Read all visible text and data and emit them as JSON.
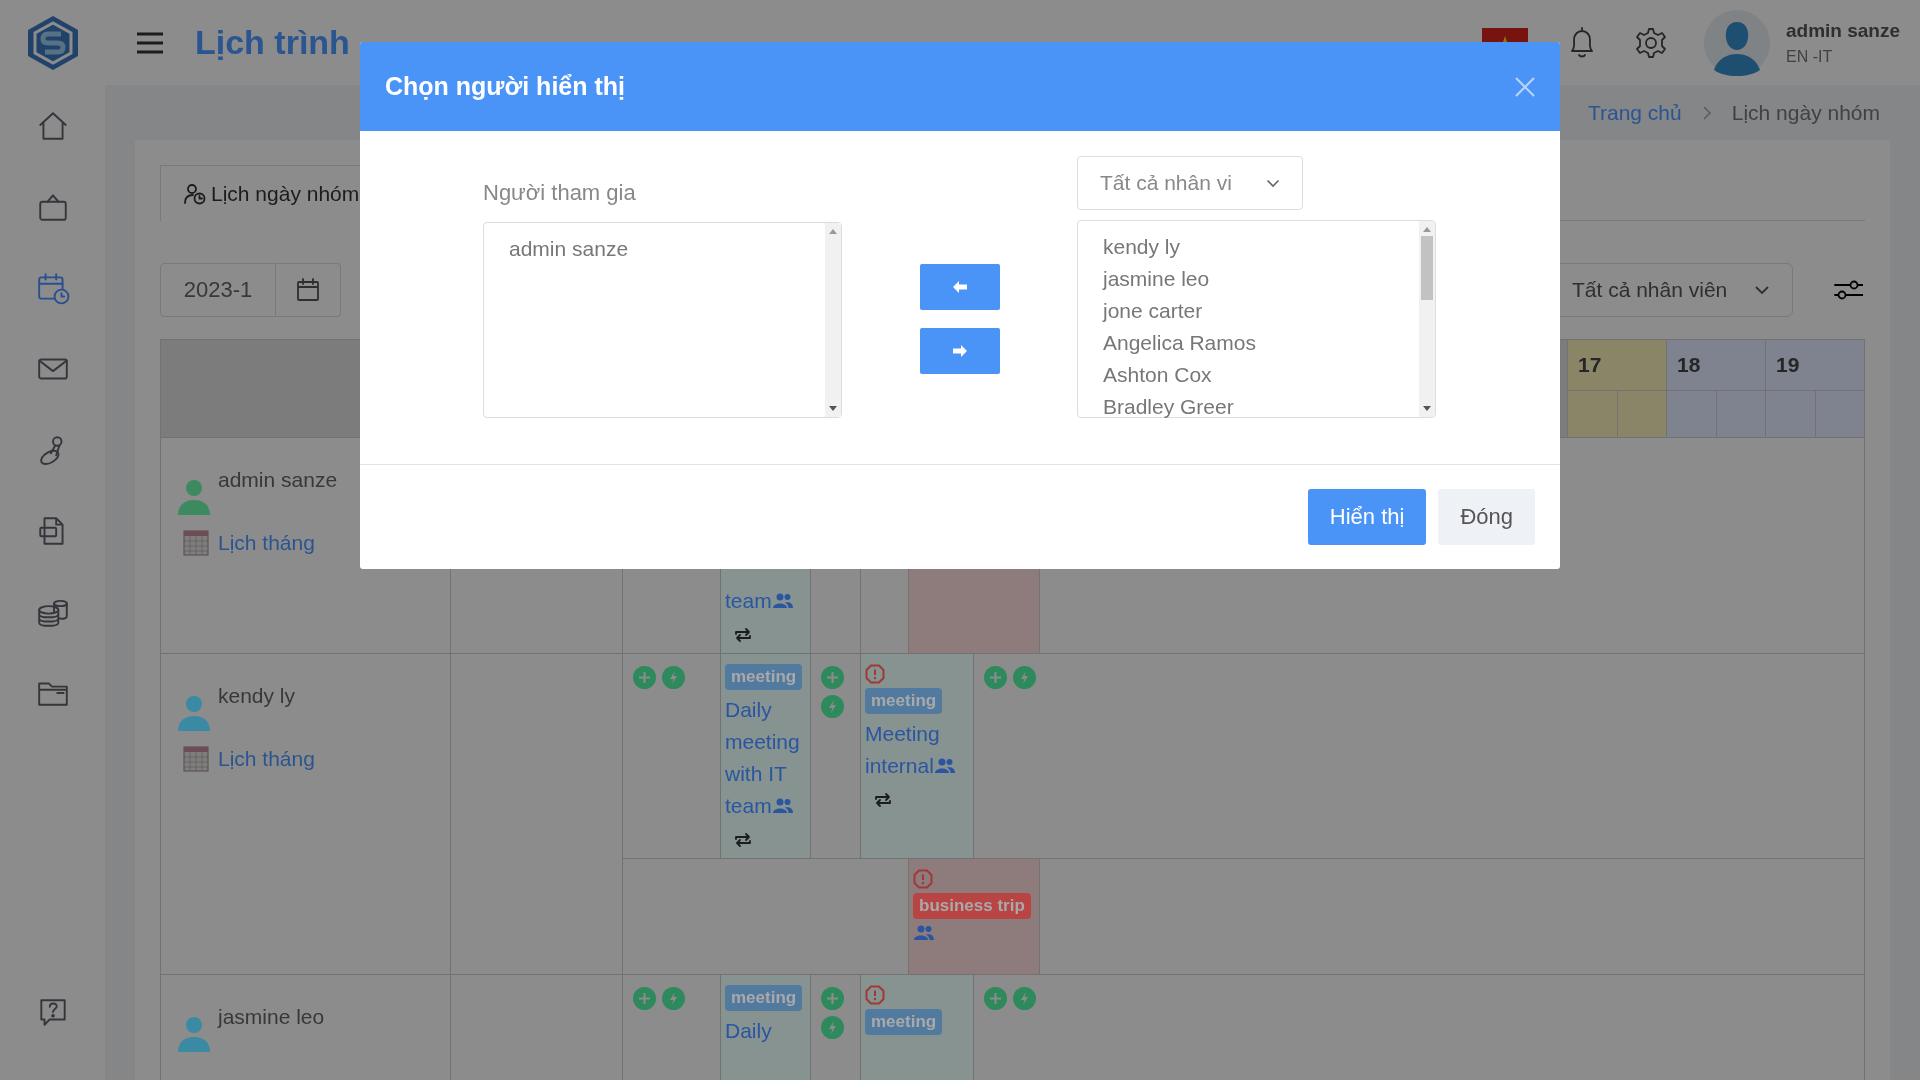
{
  "sidebar": {
    "items": [
      {
        "kind": "home",
        "selected": false
      },
      {
        "kind": "bag",
        "selected": false
      },
      {
        "kind": "calendar",
        "selected": true
      },
      {
        "kind": "mail",
        "selected": false
      },
      {
        "kind": "stamp",
        "selected": false
      },
      {
        "kind": "pdf",
        "selected": false
      },
      {
        "kind": "coins",
        "selected": false
      },
      {
        "kind": "folder",
        "selected": false
      },
      {
        "kind": "help",
        "selected": false
      }
    ]
  },
  "header": {
    "title": "Lịch trình",
    "user": {
      "name": "admin sanze",
      "detail": "EN -IT"
    }
  },
  "breadcrumb": [
    {
      "label": "Trang chủ",
      "link": true
    },
    {
      "label": "Lịch ngày nhóm",
      "link": false
    }
  ],
  "tab": {
    "label": "Lịch ngày nhóm"
  },
  "date_field": {
    "value": "2023-1"
  },
  "employee_filter": {
    "value": "Tất cả nhân viên"
  },
  "schedule": {
    "days": [
      {
        "label": "17",
        "color": "#8b8568"
      },
      {
        "label": "18",
        "color": "#7e838f"
      },
      {
        "label": "19",
        "color": "#7e838f"
      }
    ],
    "people": [
      {
        "name": "admin sanze",
        "color": "#3d8a60",
        "link": "Lịch tháng",
        "lanes": [
          {
            "cells": [
              {
                "kind": "empty"
              },
              {
                "kind": "event",
                "color": "#869391",
                "alert": false,
                "title": "team",
                "group": true,
                "repeat": true
              },
              {
                "kind": "empty"
              },
              {
                "kind": "empty"
              },
              {
                "kind": "event",
                "color": "#8e7c7c",
                "alert": false,
                "group": false,
                "repeat": false
              },
              {
                "kind": "joined"
              },
              {
                "kind": "empty"
              }
            ]
          }
        ]
      },
      {
        "name": "kendy ly",
        "color": "#3a8aa3",
        "link": "Lịch tháng",
        "lanes": [
          {
            "cells": [
              {
                "kind": "actions"
              },
              {
                "kind": "event",
                "color": "#869391",
                "alert": false,
                "badge": {
                  "label": "meeting",
                  "color": "#52799e"
                },
                "title": "Daily meeting with IT team",
                "group": true,
                "repeat": true
              },
              {
                "kind": "actions"
              },
              {
                "kind": "event",
                "color": "#869391",
                "alert": true,
                "badge": {
                  "label": "meeting",
                  "color": "#52799e"
                },
                "title": "Meeting internal",
                "group": true,
                "repeat": true
              },
              {
                "kind": "joined"
              },
              {
                "kind": "actions"
              },
              {
                "kind": "joined"
              }
            ]
          },
          {
            "cells": [
              {
                "kind": "empty"
              },
              {
                "kind": "joined"
              },
              {
                "kind": "joined"
              },
              {
                "kind": "joined"
              },
              {
                "kind": "event",
                "color": "#8e7c7c",
                "alert": true,
                "badge": {
                  "label": "business trip",
                  "color": "#b84444"
                },
                "group": true,
                "repeat": false
              },
              {
                "kind": "joined"
              },
              {
                "kind": "empty"
              }
            ]
          }
        ]
      },
      {
        "name": "jasmine leo",
        "color": "#3a8aa3",
        "lanes": [
          {
            "cells": [
              {
                "kind": "actions"
              },
              {
                "kind": "event",
                "color": "#869391",
                "alert": false,
                "badge": {
                  "label": "meeting",
                  "color": "#52799e"
                },
                "title": "Daily",
                "group": false,
                "repeat": false
              },
              {
                "kind": "actions"
              },
              {
                "kind": "event",
                "color": "#869391",
                "alert": true,
                "badge": {
                  "label": "meeting",
                  "color": "#52799e"
                },
                "group": false,
                "repeat": false
              },
              {
                "kind": "joined"
              },
              {
                "kind": "actions"
              },
              {
                "kind": "joined"
              }
            ]
          }
        ]
      }
    ]
  },
  "dialog": {
    "title": "Chọn người hiển thị",
    "participants": {
      "label": "Người tham gia",
      "items": [
        "admin sanze"
      ]
    },
    "filter": {
      "value": "Tất cả nhân vi"
    },
    "available": {
      "items": [
        "kendy ly",
        "jasmine leo",
        "jone carter",
        "Angelica Ramos",
        "Ashton Cox",
        "Bradley Greer"
      ]
    },
    "buttons": [
      {
        "label": "Hiển thị",
        "primary": true
      },
      {
        "label": "Đóng",
        "primary": false
      }
    ]
  }
}
